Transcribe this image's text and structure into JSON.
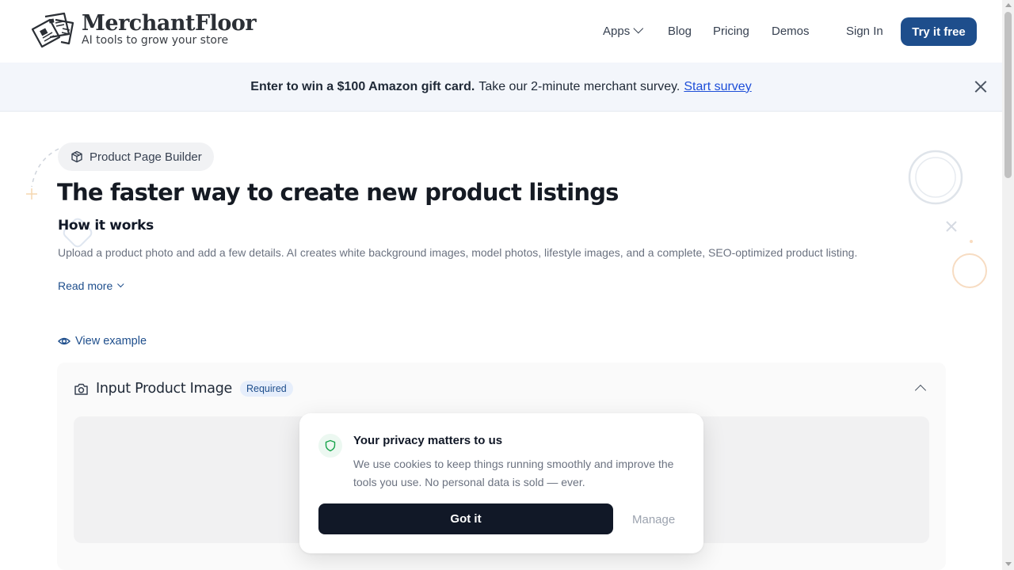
{
  "brand": {
    "name": "MerchantFloor",
    "tagline": "AI tools to grow your store"
  },
  "nav": {
    "apps": "Apps",
    "blog": "Blog",
    "pricing": "Pricing",
    "demos": "Demos",
    "sign_in": "Sign In",
    "try_free": "Try it free"
  },
  "banner": {
    "strong": "Enter to win a $100 Amazon gift card.",
    "text": "Take our 2-minute merchant survey.",
    "link": "Start survey"
  },
  "main": {
    "pill": "Product Page Builder",
    "title": "The faster way to create new product listings",
    "how_title": "How it works",
    "description": "Upload a product photo and add a few details. AI creates white background images, model photos, lifestyle images, and a complete, SEO-optimized product listing.",
    "read_more": "Read more",
    "view_example": "View example"
  },
  "input_card": {
    "title": "Input Product Image",
    "badge": "Required"
  },
  "cookie": {
    "title": "Your privacy matters to us",
    "text": "We use cookies to keep things running smoothly and improve the tools you use. No personal data is sold — ever.",
    "accept": "Got it",
    "manage": "Manage"
  },
  "colors": {
    "primary": "#1e4e8c",
    "banner_bg": "#f3f6fb",
    "dark_button": "#111827",
    "shield_green": "#16a34a"
  },
  "icons": {
    "logo": "newspaper-stack-icon",
    "apps_chevron": "chevron-down-icon",
    "banner_close": "close-icon",
    "pill": "box-icon",
    "read_more": "chevron-down-icon",
    "view_example": "eye-icon",
    "input_card": "camera-icon",
    "card_collapse": "chevron-up-icon",
    "cookie": "shield-icon"
  }
}
